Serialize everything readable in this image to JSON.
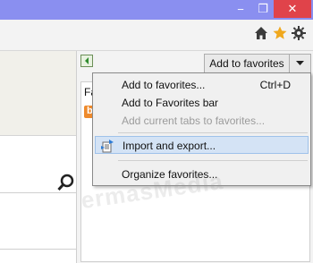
{
  "window": {
    "minimize_glyph": "−",
    "restore_glyph": "❐",
    "close_glyph": "✕",
    "titlebar_color": "#8a8ff0",
    "close_color": "#e0434a"
  },
  "toolbar": {
    "icons": [
      "home-icon",
      "star-icon",
      "gear-icon"
    ],
    "star_color": "#f0a81d"
  },
  "favorites_panel": {
    "add_button_label": "Add to favorites",
    "tab_label": "Fa",
    "item_icon_letter": "b"
  },
  "menu": {
    "items": [
      {
        "label": "Add to favorites...",
        "shortcut": "Ctrl+D",
        "enabled": true
      },
      {
        "label": "Add to Favorites bar",
        "shortcut": "",
        "enabled": true
      },
      {
        "label": "Add current tabs to favorites...",
        "shortcut": "",
        "enabled": false
      },
      {
        "label": "Import and export...",
        "shortcut": "",
        "enabled": true,
        "highlighted": true
      },
      {
        "label": "Organize favorites...",
        "shortcut": "",
        "enabled": true
      }
    ]
  },
  "watermark": "ermasMedia"
}
